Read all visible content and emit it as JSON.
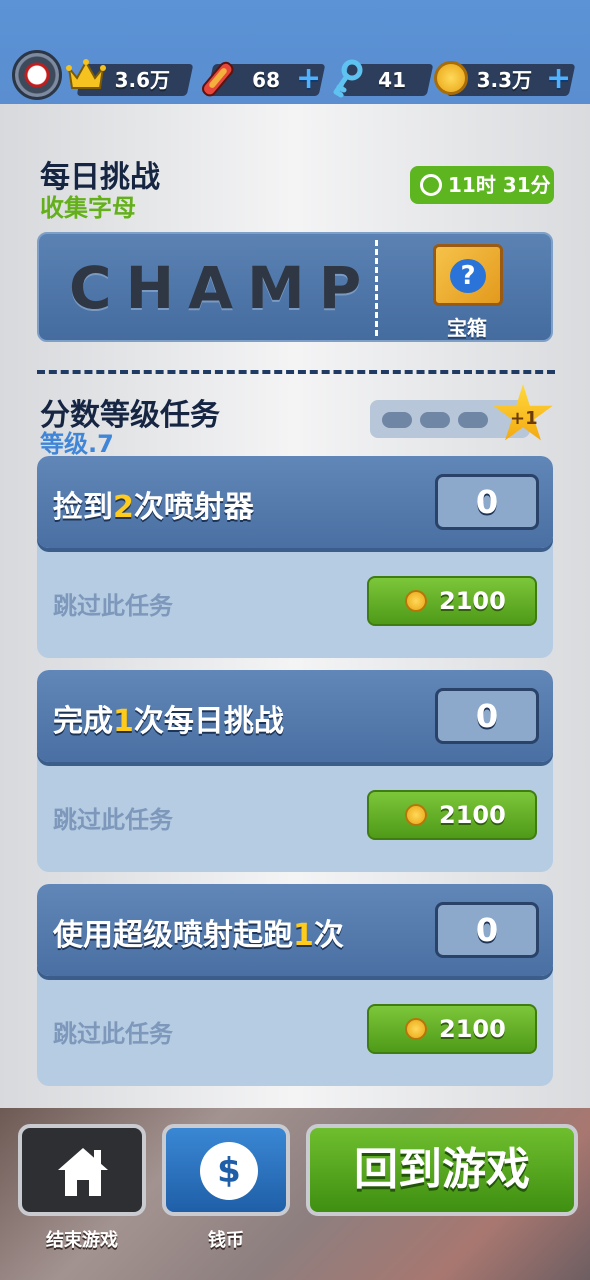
{
  "topbar": {
    "crown_value": "3.6万",
    "board_value": "68",
    "key_value": "41",
    "coin_value": "3.3万",
    "plus": "+"
  },
  "daily": {
    "title": "每日挑战",
    "subtitle": "收集字母",
    "timer": "11时 31分",
    "letters": "CHAMP",
    "chest_label": "宝箱",
    "chest_symbol": "?"
  },
  "missions": {
    "title": "分数等级任务",
    "level": "等级.7",
    "star_label": "+1",
    "tasks": [
      {
        "pre": "捡到",
        "num": "2",
        "post": "次喷射器",
        "count": "0",
        "skip": "跳过此任务",
        "price": "2100"
      },
      {
        "pre": "完成",
        "num": "1",
        "post": "次每日挑战",
        "count": "0",
        "skip": "跳过此任务",
        "price": "2100"
      },
      {
        "pre": "使用超级喷射起跑",
        "num": "1",
        "post": "次",
        "count": "0",
        "skip": "跳过此任务",
        "price": "2100"
      }
    ]
  },
  "bottom": {
    "end_label": "结束游戏",
    "coins_label": "钱币",
    "coin_symbol": "$",
    "resume_label": "回到游戏"
  },
  "colors": {
    "accent_green": "#5db61f",
    "highlight_yellow": "#ffcc1e",
    "card_blue": "#4a70a3"
  }
}
